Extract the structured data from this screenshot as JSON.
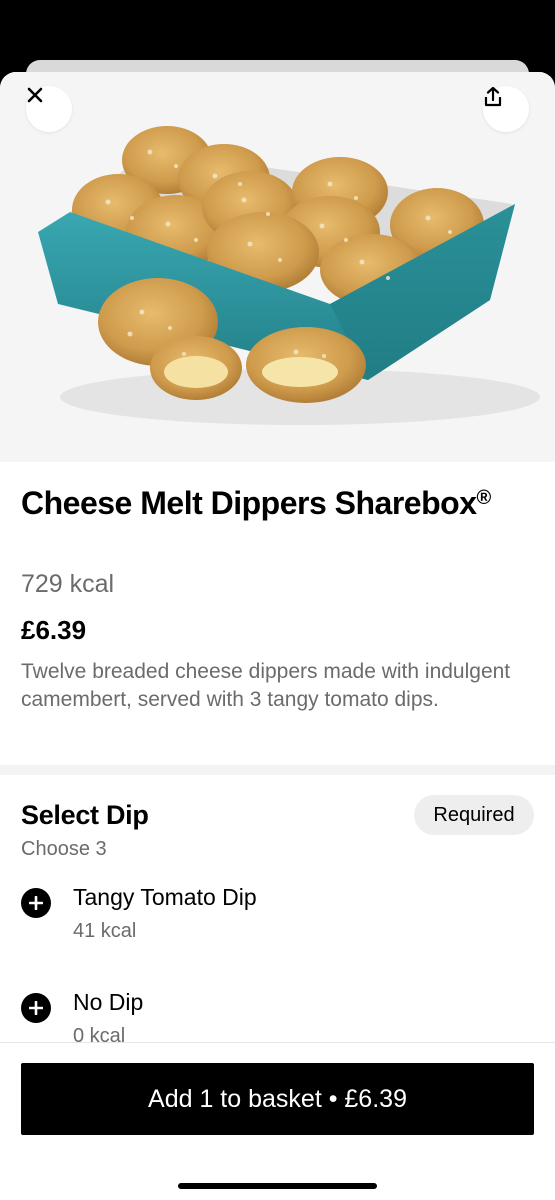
{
  "product": {
    "title": "Cheese Melt Dippers Sharebox",
    "title_mark": "®",
    "kcal": "729 kcal",
    "price": "£6.39",
    "description": "Twelve breaded cheese dippers made with indulgent camembert, served with 3 tangy tomato dips."
  },
  "hero": {
    "image_subject": "cheese melt dippers in teal box",
    "box_color": "#2e99a3",
    "close_icon": "close-icon",
    "share_icon": "share-icon"
  },
  "dip_section": {
    "title": "Select Dip",
    "subtitle": "Choose 3",
    "badge": "Required",
    "options": [
      {
        "name": "Tangy Tomato Dip",
        "kcal": "41 kcal"
      },
      {
        "name": "No Dip",
        "kcal": "0 kcal"
      }
    ]
  },
  "footer": {
    "cta_label": "Add 1 to basket • £6.39"
  },
  "colors": {
    "accent": "#000000",
    "muted_text": "#6b6b6b",
    "badge_bg": "#eeeeee"
  }
}
